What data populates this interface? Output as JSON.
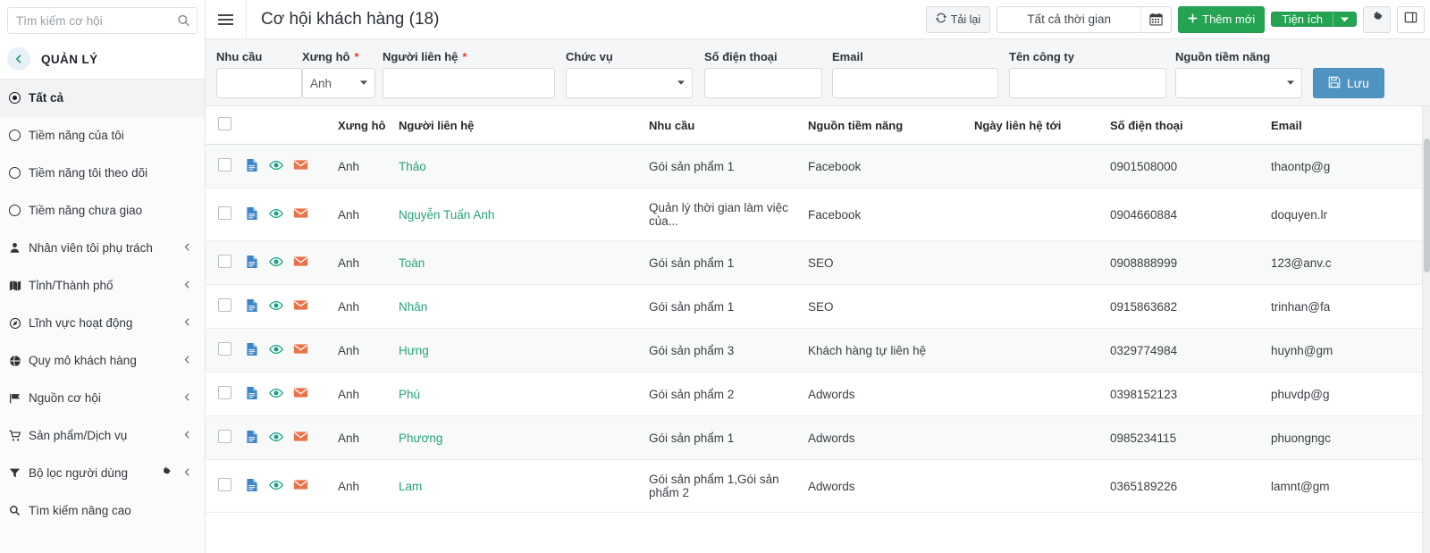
{
  "sidebar": {
    "search": {
      "placeholder": "Tìm kiếm cơ hội",
      "value": "",
      "icon": "search-icon"
    },
    "section_label": "QUẢN LÝ",
    "back_icon": "chevron-left-icon",
    "items": [
      {
        "label": "Tất cả",
        "icon": "radio-selected-icon",
        "active": true,
        "chevron": false,
        "gear": false
      },
      {
        "label": "Tiềm năng của tôi",
        "icon": "radio-icon",
        "active": false,
        "chevron": false,
        "gear": false
      },
      {
        "label": "Tiềm năng tôi theo dõi",
        "icon": "radio-icon",
        "active": false,
        "chevron": false,
        "gear": false
      },
      {
        "label": "Tiềm năng chưa giao",
        "icon": "radio-icon",
        "active": false,
        "chevron": false,
        "gear": false
      },
      {
        "label": "Nhân viên tôi phụ trách",
        "icon": "user-icon",
        "active": false,
        "chevron": true,
        "gear": false
      },
      {
        "label": "Tỉnh/Thành phố",
        "icon": "map-icon",
        "active": false,
        "chevron": true,
        "gear": false
      },
      {
        "label": "Lĩnh vực hoạt động",
        "icon": "compass-icon",
        "active": false,
        "chevron": true,
        "gear": false
      },
      {
        "label": "Quy mô khách hàng",
        "icon": "globe-icon",
        "active": false,
        "chevron": true,
        "gear": false
      },
      {
        "label": "Nguồn cơ hội",
        "icon": "flag-icon",
        "active": false,
        "chevron": true,
        "gear": false
      },
      {
        "label": "Sản phẩm/Dịch vụ",
        "icon": "cart-icon",
        "active": false,
        "chevron": true,
        "gear": false
      },
      {
        "label": "Bộ lọc người dùng",
        "icon": "filter-icon",
        "active": false,
        "chevron": true,
        "gear": true
      },
      {
        "label": "Tìm kiếm nâng cao",
        "icon": "search-icon",
        "active": false,
        "chevron": false,
        "gear": false
      }
    ]
  },
  "header": {
    "menu_icon": "hamburger-icon",
    "title": "Cơ hội khách hàng (18)",
    "reload_label": "Tải lại",
    "reload_icon": "refresh-icon",
    "daterange_value": "Tất cả thời gian",
    "calendar_icon": "calendar-icon",
    "add_label": "Thêm mới",
    "add_icon": "plus-icon",
    "utility_label": "Tiện ích",
    "utility_caret": "chevron-down-icon",
    "settings_icon": "gear-icon",
    "columns_icon": "columns-icon"
  },
  "filters": {
    "fields": [
      {
        "label": "Nhu cầu",
        "required": false,
        "type": "text",
        "value": ""
      },
      {
        "label": "Xưng hô",
        "required": true,
        "type": "select",
        "value": "Anh"
      },
      {
        "label": "Người liên hệ",
        "required": true,
        "type": "text",
        "value": ""
      },
      {
        "label": "Chức vụ",
        "required": false,
        "type": "select",
        "value": ""
      },
      {
        "label": "Số điện thoại",
        "required": false,
        "type": "text",
        "value": ""
      },
      {
        "label": "Email",
        "required": false,
        "type": "text",
        "value": ""
      },
      {
        "label": "Tên công ty",
        "required": false,
        "type": "text",
        "value": ""
      },
      {
        "label": "Nguồn tiềm năng",
        "required": false,
        "type": "select",
        "value": ""
      }
    ],
    "save_label": "Lưu",
    "save_icon": "save-icon",
    "save_color": "#4f93c0"
  },
  "table": {
    "columns": [
      "",
      "",
      "Xưng hô",
      "Người liên hệ",
      "Nhu cầu",
      "Nguồn tiềm năng",
      "Ngày liên hệ tới",
      "Số điện thoại",
      "Email"
    ],
    "row_icons": [
      "document-icon",
      "eye-icon",
      "mail-icon"
    ],
    "rows": [
      {
        "xung_ho": "Anh",
        "nguoi_lien_he": "Thảo",
        "nhu_cau": "Gói sản phẩm 1",
        "nguon": "Facebook",
        "ngay": "",
        "sdt": "0901508000",
        "email": "thaontp@g"
      },
      {
        "xung_ho": "Anh",
        "nguoi_lien_he": "Nguyễn Tuấn Anh",
        "nhu_cau": "Quản lý thời gian làm việc của...",
        "nguon": "Facebook",
        "ngay": "",
        "sdt": "0904660884",
        "email": "doquyen.lr"
      },
      {
        "xung_ho": "Anh",
        "nguoi_lien_he": "Toàn",
        "nhu_cau": "Gói sản phẩm 1",
        "nguon": "SEO",
        "ngay": "",
        "sdt": "0908888999",
        "email": "123@anv.c"
      },
      {
        "xung_ho": "Anh",
        "nguoi_lien_he": "Nhân",
        "nhu_cau": "Gói sản phẩm 1",
        "nguon": "SEO",
        "ngay": "",
        "sdt": "0915863682",
        "email": "trinhan@fa"
      },
      {
        "xung_ho": "Anh",
        "nguoi_lien_he": "Hưng",
        "nhu_cau": "Gói sản phẩm 3",
        "nguon": "Khách hàng tự liên hệ",
        "ngay": "",
        "sdt": "0329774984",
        "email": "huynh@gm"
      },
      {
        "xung_ho": "Anh",
        "nguoi_lien_he": "Phú",
        "nhu_cau": "Gói sản phẩm 2",
        "nguon": "Adwords",
        "ngay": "",
        "sdt": "0398152123",
        "email": "phuvdp@g"
      },
      {
        "xung_ho": "Anh",
        "nguoi_lien_he": "Phương",
        "nhu_cau": "Gói sản phẩm 1",
        "nguon": "Adwords",
        "ngay": "",
        "sdt": "0985234115",
        "email": "phuongngc"
      },
      {
        "xung_ho": "Anh",
        "nguoi_lien_he": "Lam",
        "nhu_cau": "Gói sản phẩm 1,Gói sản phẩm 2",
        "nguon": "Adwords",
        "ngay": "",
        "sdt": "0365189226",
        "email": "lamnt@gm"
      }
    ]
  },
  "colors": {
    "green": "#24a453",
    "link_green": "#26a37e",
    "save_blue": "#4f93c0",
    "doc_blue": "#3b86c8",
    "eye_green": "#16a085",
    "mail_orange": "#e8734a",
    "required_red": "#e8392f"
  }
}
